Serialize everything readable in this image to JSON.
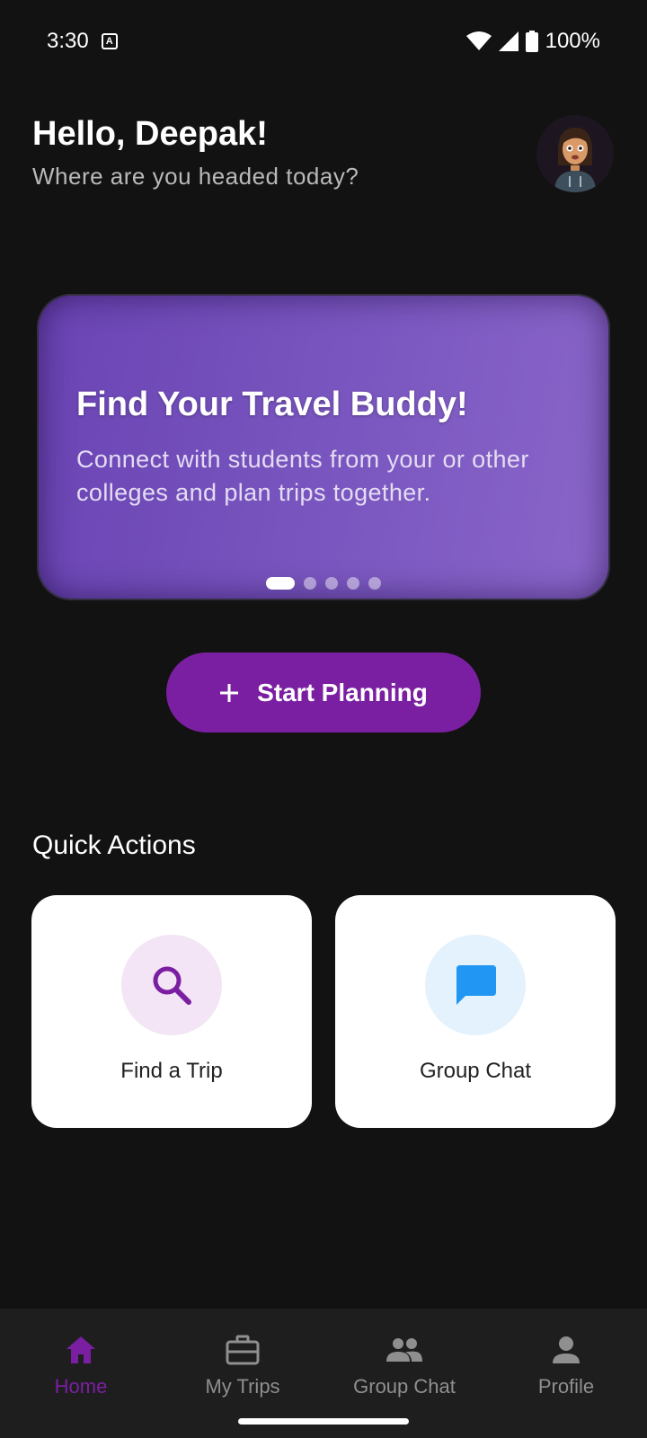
{
  "status_bar": {
    "time": "3:30",
    "notification_icon": "a-icon",
    "battery": "100%"
  },
  "header": {
    "title": "Hello, Deepak!",
    "subtitle": "Where are you headed today?"
  },
  "banner": {
    "title": "Find Your Travel Buddy!",
    "text": "Connect with students from your or other colleges and plan trips together.",
    "slide_count": 5,
    "active_slide": 1
  },
  "start_button": {
    "label": "Start Planning",
    "icon": "plus-icon"
  },
  "quick_actions": {
    "title": "Quick Actions",
    "items": [
      {
        "label": "Find a Trip",
        "icon": "search-icon",
        "icon_color": "#7b1fa2",
        "bg_color": "#f3e5f5"
      },
      {
        "label": "Group Chat",
        "icon": "chat-icon",
        "icon_color": "#2196f3",
        "bg_color": "#e3f2fd"
      }
    ]
  },
  "bottom_nav": {
    "items": [
      {
        "label": "Home",
        "icon": "home-icon",
        "active": true
      },
      {
        "label": "My Trips",
        "icon": "briefcase-icon",
        "active": false
      },
      {
        "label": "Group Chat",
        "icon": "people-icon",
        "active": false
      },
      {
        "label": "Profile",
        "icon": "person-icon",
        "active": false
      }
    ]
  },
  "colors": {
    "background": "#121212",
    "accent": "#7b1fa2",
    "banner_start": "#6a44b4",
    "banner_end": "#8a66c9",
    "nav_bg": "#1e1e1e"
  }
}
